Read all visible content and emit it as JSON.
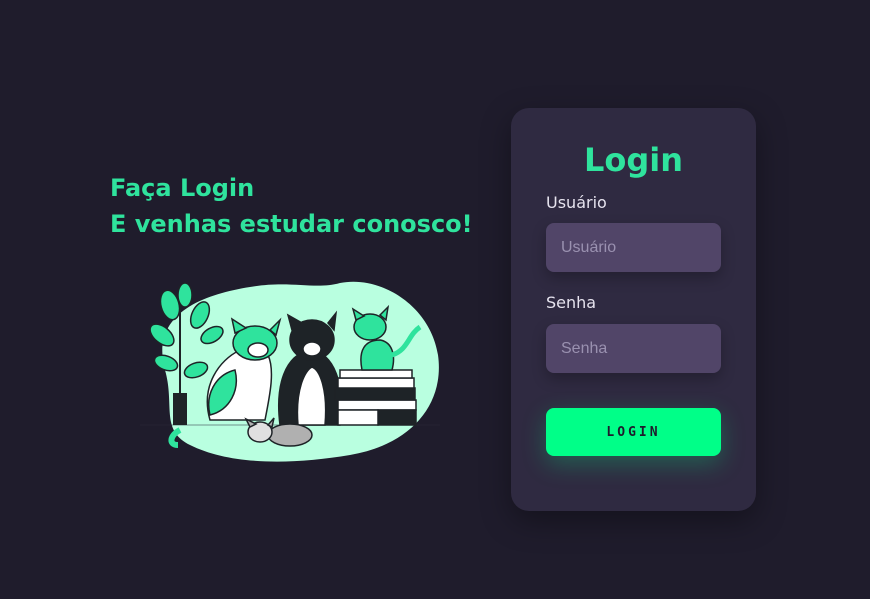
{
  "hero": {
    "line1": "Faça Login",
    "line2": "E venhas estudar conosco!"
  },
  "illustration": {
    "description_icon": "cats-illustration"
  },
  "login_card": {
    "title": "Login",
    "username_label": "Usuário",
    "username_placeholder": "Usuário",
    "password_label": "Senha",
    "password_placeholder": "Senha",
    "submit_label": "LOGIN"
  },
  "colors": {
    "background": "#1f1c2c",
    "accent": "#00ff88",
    "heading_green": "#2fe39d",
    "card": "#2f2a41",
    "input": "#514568"
  }
}
